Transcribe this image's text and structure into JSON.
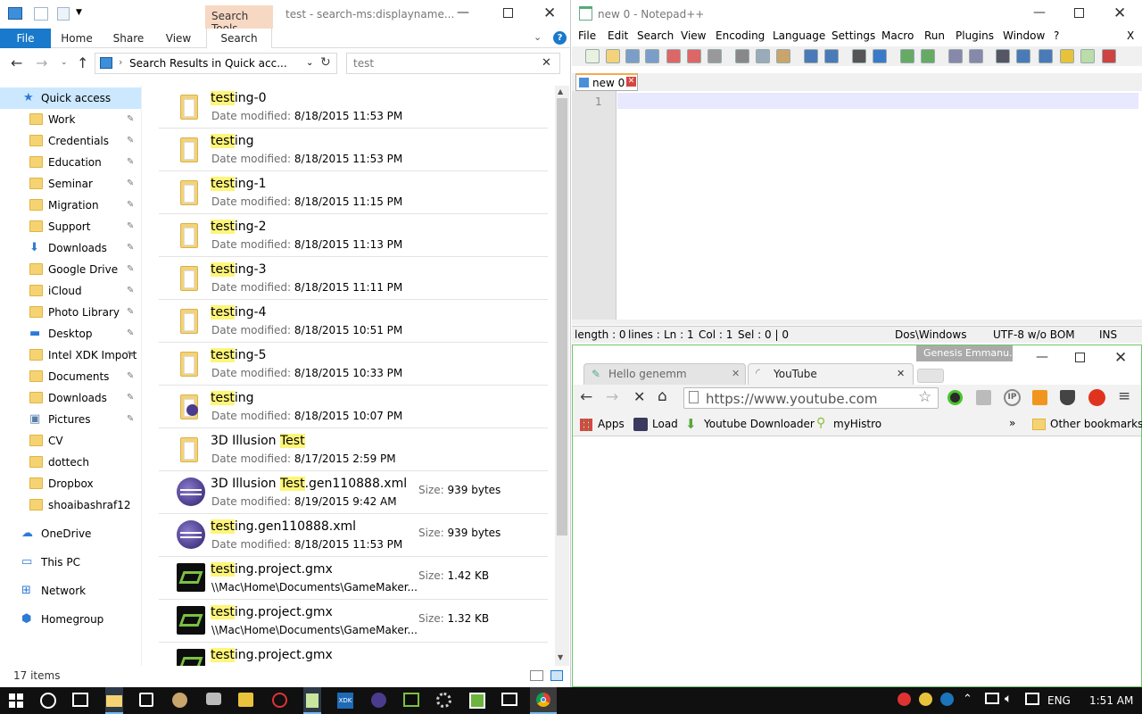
{
  "explorer": {
    "title": "test - search-ms:displayname...",
    "search_tools": "Search Tools",
    "tabs": [
      "File",
      "Home",
      "Share",
      "View",
      "Search"
    ],
    "address": "Search Results in Quick acc...",
    "search_value": "test",
    "status": "17 items",
    "sidebar": [
      {
        "label": "Quick access",
        "icon": "star-icon",
        "pin": false
      },
      {
        "label": "Work",
        "icon": "folder-icon",
        "pin": true
      },
      {
        "label": "Credentials",
        "icon": "folder-icon",
        "pin": true
      },
      {
        "label": "Education",
        "icon": "folder-icon",
        "pin": true
      },
      {
        "label": "Seminar",
        "icon": "folder-icon",
        "pin": true
      },
      {
        "label": "Migration",
        "icon": "folder-icon",
        "pin": true
      },
      {
        "label": "Support",
        "icon": "folder-icon",
        "pin": true
      },
      {
        "label": "Downloads",
        "icon": "download-icon",
        "pin": true
      },
      {
        "label": "Google Drive",
        "icon": "folder-icon",
        "pin": true
      },
      {
        "label": "iCloud",
        "icon": "folder-icon",
        "pin": true
      },
      {
        "label": "Photo Library",
        "icon": "folder-icon",
        "pin": true
      },
      {
        "label": "Desktop",
        "icon": "desktop-icon",
        "pin": true
      },
      {
        "label": "Intel XDK Import",
        "icon": "folder-icon",
        "pin": true
      },
      {
        "label": "Documents",
        "icon": "folder-icon",
        "pin": true
      },
      {
        "label": "Downloads",
        "icon": "folder-icon",
        "pin": true
      },
      {
        "label": "Pictures",
        "icon": "pictures-icon",
        "pin": true
      },
      {
        "label": "CV",
        "icon": "folder-icon",
        "pin": false
      },
      {
        "label": "dottech",
        "icon": "folder-icon",
        "pin": false
      },
      {
        "label": "Dropbox",
        "icon": "folder-icon",
        "pin": false
      },
      {
        "label": "shoaibashraf12",
        "icon": "folder-icon",
        "pin": false
      },
      {
        "label": "OneDrive",
        "icon": "cloud-icon",
        "pin": false
      },
      {
        "label": "This PC",
        "icon": "computer-icon",
        "pin": false
      },
      {
        "label": "Network",
        "icon": "network-icon",
        "pin": false
      },
      {
        "label": "Homegroup",
        "icon": "homegroup-icon",
        "pin": false
      }
    ],
    "files": [
      {
        "pre": "",
        "hl": "test",
        "post": "ing-0",
        "meta_key": "Date modified:",
        "meta_val": "8/18/2015 11:53 PM",
        "size_key": "",
        "size_val": "",
        "icon": "folder"
      },
      {
        "pre": "",
        "hl": "test",
        "post": "ing",
        "meta_key": "Date modified:",
        "meta_val": "8/18/2015 11:53 PM",
        "size_key": "",
        "size_val": "",
        "icon": "folder"
      },
      {
        "pre": "",
        "hl": "test",
        "post": "ing-1",
        "meta_key": "Date modified:",
        "meta_val": "8/18/2015 11:15 PM",
        "size_key": "",
        "size_val": "",
        "icon": "folder"
      },
      {
        "pre": "",
        "hl": "test",
        "post": "ing-2",
        "meta_key": "Date modified:",
        "meta_val": "8/18/2015 11:13 PM",
        "size_key": "",
        "size_val": "",
        "icon": "folder"
      },
      {
        "pre": "",
        "hl": "test",
        "post": "ing-3",
        "meta_key": "Date modified:",
        "meta_val": "8/18/2015 11:11 PM",
        "size_key": "",
        "size_val": "",
        "icon": "folder"
      },
      {
        "pre": "",
        "hl": "test",
        "post": "ing-4",
        "meta_key": "Date modified:",
        "meta_val": "8/18/2015 10:51 PM",
        "size_key": "",
        "size_val": "",
        "icon": "folder"
      },
      {
        "pre": "",
        "hl": "test",
        "post": "ing-5",
        "meta_key": "Date modified:",
        "meta_val": "8/18/2015 10:33 PM",
        "size_key": "",
        "size_val": "",
        "icon": "folder"
      },
      {
        "pre": "",
        "hl": "test",
        "post": "ing",
        "meta_key": "Date modified:",
        "meta_val": "8/18/2015 10:07 PM",
        "size_key": "",
        "size_val": "",
        "icon": "folder-eclipse"
      },
      {
        "pre": "3D Illusion ",
        "hl": "Test",
        "post": "",
        "meta_key": "Date modified:",
        "meta_val": "8/17/2015 2:59 PM",
        "size_key": "",
        "size_val": "",
        "icon": "folder"
      },
      {
        "pre": "3D Illusion ",
        "hl": "Test",
        "post": ".gen110888.xml",
        "meta_key": "Date modified:",
        "meta_val": "8/19/2015 9:42 AM",
        "size_key": "Size:",
        "size_val": "939 bytes",
        "icon": "eclipse"
      },
      {
        "pre": "",
        "hl": "test",
        "post": "ing.gen110888.xml",
        "meta_key": "Date modified:",
        "meta_val": "8/18/2015 11:53 PM",
        "size_key": "Size:",
        "size_val": "939 bytes",
        "icon": "eclipse"
      },
      {
        "pre": "",
        "hl": "test",
        "post": "ing.project.gmx",
        "meta_key": "",
        "meta_val": "\\\\Mac\\Home\\Documents\\GameMaker...",
        "size_key": "Size:",
        "size_val": "1.42 KB",
        "icon": "gamemaker"
      },
      {
        "pre": "",
        "hl": "test",
        "post": "ing.project.gmx",
        "meta_key": "",
        "meta_val": "\\\\Mac\\Home\\Documents\\GameMaker...",
        "size_key": "Size:",
        "size_val": "1.32 KB",
        "icon": "gamemaker"
      },
      {
        "pre": "",
        "hl": "test",
        "post": "ing.project.gmx",
        "meta_key": "",
        "meta_val": "",
        "size_key": "",
        "size_val": "",
        "icon": "gamemaker"
      }
    ]
  },
  "notepad": {
    "title": "new 0 - Notepad++",
    "menu": [
      "File",
      "Edit",
      "Search",
      "View",
      "Encoding",
      "Language",
      "Settings",
      "Macro",
      "Run",
      "Plugins",
      "Window",
      "?"
    ],
    "close_x": "X",
    "tab": "new 0",
    "line_no": "1",
    "status": {
      "length": "length : 0",
      "lines": "lines :",
      "ln": "Ln : 1",
      "col": "Col : 1",
      "sel": "Sel : 0 | 0",
      "eol": "Dos\\Windows",
      "enc": "UTF-8 w/o BOM",
      "mode": "INS"
    }
  },
  "chrome": {
    "profile": "Genesis Emmanu...",
    "tab1": "Hello genemm",
    "tab2": "YouTube",
    "url": "https://www.youtube.com",
    "bookmarks": [
      "Apps",
      "Load",
      "Youtube Downloader",
      "myHistro"
    ],
    "more": "»",
    "other": "Other bookmarks"
  },
  "taskbar": {
    "lang": "ENG",
    "time": "1:51 AM"
  },
  "colors": {
    "accent": "#1979ca",
    "highlight": "#fef57a",
    "taskbar": "#101010",
    "chrome_border": "#6ec56a"
  }
}
